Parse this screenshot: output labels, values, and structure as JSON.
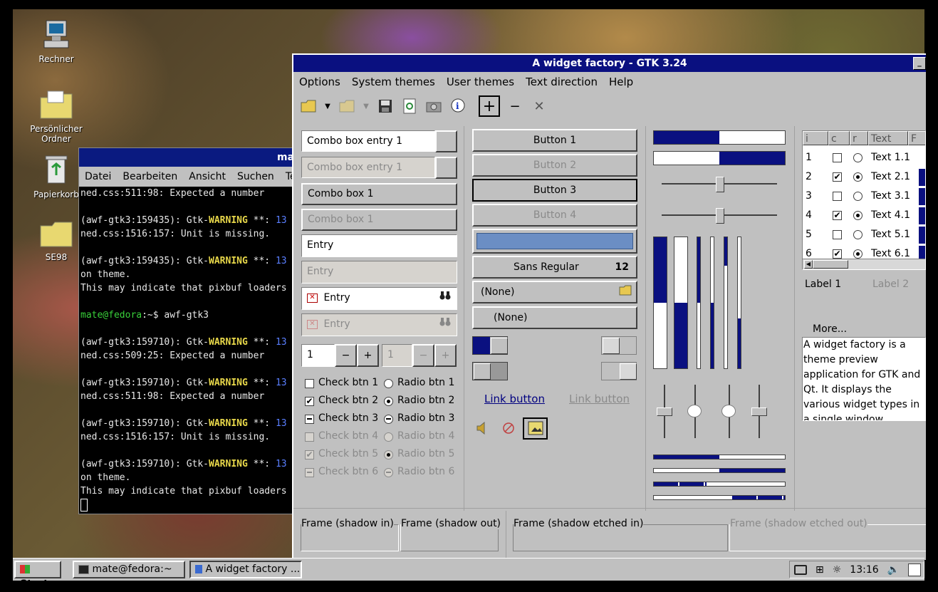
{
  "desktop": {
    "icons": [
      {
        "label": "Rechner"
      },
      {
        "label": "Persönlicher Ordner"
      },
      {
        "label": "Papierkorb"
      },
      {
        "label": "SE98"
      }
    ]
  },
  "terminal": {
    "title": "ma",
    "menu": [
      "Datei",
      "Bearbeiten",
      "Ansicht",
      "Suchen",
      "Te"
    ],
    "lines": [
      {
        "t": "ned.css:511:98: Expected a number"
      },
      {
        "t": ""
      },
      {
        "pre": "(awf-gtk3:159435): Gtk-",
        "warn": "WARNING",
        "post": " **: ",
        "blue": "13"
      },
      {
        "t": "ned.css:1516:157: Unit is missing."
      },
      {
        "t": ""
      },
      {
        "pre": "(awf-gtk3:159435): Gtk-",
        "warn": "WARNING",
        "post": " **: ",
        "blue": "13"
      },
      {
        "t": "on theme."
      },
      {
        "t": "This may indicate that pixbuf loaders"
      },
      {
        "t": ""
      },
      {
        "prompt": "mate@fedora",
        "rest": ":~$ awf-gtk3"
      },
      {
        "t": ""
      },
      {
        "pre": "(awf-gtk3:159710): Gtk-",
        "warn": "WARNING",
        "post": " **: ",
        "blue": "13"
      },
      {
        "t": "ned.css:509:25: Expected a number"
      },
      {
        "t": ""
      },
      {
        "pre": "(awf-gtk3:159710): Gtk-",
        "warn": "WARNING",
        "post": " **: ",
        "blue": "13"
      },
      {
        "t": "ned.css:511:98: Expected a number"
      },
      {
        "t": ""
      },
      {
        "pre": "(awf-gtk3:159710): Gtk-",
        "warn": "WARNING",
        "post": " **: ",
        "blue": "13"
      },
      {
        "t": "ned.css:1516:157: Unit is missing."
      },
      {
        "t": ""
      },
      {
        "pre": "(awf-gtk3:159710): Gtk-",
        "warn": "WARNING",
        "post": " **: ",
        "blue": "13"
      },
      {
        "t": "on theme."
      },
      {
        "t": "This may indicate that pixbuf loaders"
      }
    ]
  },
  "window": {
    "title": "A widget factory - GTK 3.24",
    "menu": [
      "Options",
      "System themes",
      "User themes",
      "Text direction",
      "Help"
    ],
    "toolbar": {
      "plus": "+",
      "minus": "−",
      "close": "✕"
    },
    "combo_entry_1": "Combo box entry 1",
    "combo_entry_1_dis": "Combo box entry 1",
    "combo_1": "Combo box 1",
    "combo_1_dis": "Combo box 1",
    "entry": "Entry",
    "entry_dis": "Entry",
    "entry_icon": "Entry",
    "entry_icon_dis": "Entry",
    "spin_value": "1",
    "spin_value_dis": "1",
    "spin_minus": "−",
    "spin_plus": "+",
    "checks": [
      {
        "label": "Check btn 1",
        "state": "off"
      },
      {
        "label": "Check btn 2",
        "state": "on"
      },
      {
        "label": "Check btn 3",
        "state": "mixed"
      },
      {
        "label": "Check btn 4",
        "state": "off"
      },
      {
        "label": "Check btn 5",
        "state": "on"
      },
      {
        "label": "Check btn 6",
        "state": "mixed"
      }
    ],
    "radios": [
      {
        "label": "Radio btn 1",
        "state": "off"
      },
      {
        "label": "Radio btn 2",
        "state": "on"
      },
      {
        "label": "Radio btn 3",
        "state": "mixed"
      },
      {
        "label": "Radio btn 4",
        "state": "off"
      },
      {
        "label": "Radio btn 5",
        "state": "on"
      },
      {
        "label": "Radio btn 6",
        "state": "mixed"
      }
    ],
    "buttons": [
      "Button 1",
      "Button 2",
      "Button 3",
      "Button 4"
    ],
    "font_button": {
      "name": "Sans Regular",
      "size": "12"
    },
    "file_chooser_1": "(None)",
    "file_chooser_2": "(None)",
    "link_button_1": "Link button",
    "link_button_2": "Link button",
    "progress": {
      "h1": 0.5,
      "h2": 0.5
    },
    "tree": {
      "headers": [
        "i",
        "c",
        "r",
        "Text",
        "F"
      ],
      "rows": [
        {
          "num": "1",
          "check": false,
          "radio": false,
          "text": "Text 1.1"
        },
        {
          "num": "2",
          "check": true,
          "radio": true,
          "text": "Text 2.1"
        },
        {
          "num": "3",
          "check": false,
          "radio": false,
          "text": "Text 3.1"
        },
        {
          "num": "4",
          "check": true,
          "radio": true,
          "text": "Text 4.1"
        },
        {
          "num": "5",
          "check": false,
          "radio": false,
          "text": "Text 5.1"
        },
        {
          "num": "6",
          "check": true,
          "radio": true,
          "text": "Text 6.1"
        }
      ]
    },
    "label_1": "Label 1",
    "label_2": "Label 2",
    "expander": "More...",
    "textview": "A widget factory is a theme preview application for GTK and Qt. It displays the various widget types in a single window allowing to see",
    "frames": [
      "Frame (shadow in)",
      "Frame (shadow out)",
      "Frame (shadow etched in)",
      "Frame (shadow etched out)"
    ]
  },
  "taskbar": {
    "start": "Start",
    "tasks": [
      "mate@fedora:~",
      "A widget factory ..."
    ],
    "clock": "13:16"
  },
  "colors": {
    "accent": "#0a1080",
    "face": "#c0c0c0",
    "warning": "#e8d84a",
    "prompt": "#39d13a"
  }
}
